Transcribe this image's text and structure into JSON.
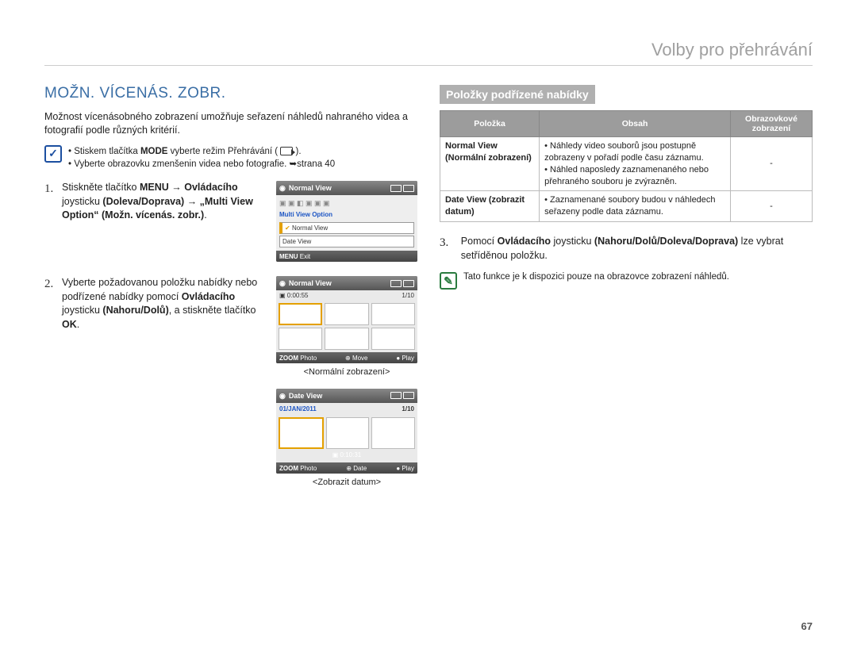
{
  "chapter": "Volby pro přehrávání",
  "section_title": "MOŽN. VÍCENÁS. ZOBR.",
  "intro": "Možnost vícenásobného zobrazení umožňuje seřazení náhledů nahraného videa a fotografií podle různých kritérií.",
  "prereq": {
    "line1_a": "Stiskem tlačítka ",
    "line1_b": "MODE",
    "line1_c": " vyberte režim Přehrávání ( ",
    "line1_d": " ).",
    "line2": "Vyberte obrazovku zmenšenin videa nebo fotografie. ➥strana 40"
  },
  "steps": {
    "s1": {
      "t1": "Stiskněte tlačítko ",
      "t2": "MENU",
      "t3": " → ",
      "t4": "Ovládacího",
      "t5": " joysticku ",
      "t6": "(Doleva/Doprava)",
      "t7": " → ",
      "t8": "„Multi View Option“ (Možn. vícenás. zobr.)",
      "t9": "."
    },
    "s2": {
      "t1": "Vyberte požadovanou položku nabídky nebo podřízené nabídky pomocí ",
      "t2": "Ovládacího",
      "t3": " joysticku ",
      "t4": "(Nahoru/Dolů)",
      "t5": ", a stiskněte tlačítko ",
      "t6": "OK",
      "t7": "."
    }
  },
  "lcd1": {
    "title": "Normal View",
    "menu_header": "Multi View Option",
    "item1": "Normal View",
    "item2": "Date View",
    "menu_btn": "MENU",
    "exit": "Exit"
  },
  "lcd2": {
    "title": "Normal View",
    "time": "0:00:55",
    "counter": "1/10",
    "zoom": "ZOOM",
    "photo": "Photo",
    "move": "Move",
    "play": "Play",
    "caption": "<Normální zobrazení>"
  },
  "lcd3": {
    "title": "Date View",
    "date": "01/JAN/2011",
    "counter": "1/10",
    "time": "0:10:31",
    "zoom": "ZOOM",
    "photo": "Photo",
    "dateLbl": "Date",
    "play": "Play",
    "caption": "<Zobrazit datum>"
  },
  "submenu_head": "Položky podřízené nabídky",
  "table": {
    "h1": "Položka",
    "h2": "Obsah",
    "h3": "Obrazovkové zobrazení",
    "r1": {
      "item": "Normal View (Normální zobrazení)",
      "c1": "Náhledy video souborů jsou postupně zobrazeny v pořadí podle času záznamu.",
      "c2": "Náhled naposledy zaznamenaného nebo přehraného souboru je zvýrazněn.",
      "disp": "-"
    },
    "r2": {
      "item": "Date View (zobrazit datum)",
      "c1": "Zaznamenané soubory budou v náhledech seřazeny podle data záznamu.",
      "disp": "-"
    }
  },
  "step3": {
    "t1": "Pomocí ",
    "t2": "Ovládacího",
    "t3": " joysticku ",
    "t4": "(Nahoru/Dolů/Doleva/Doprava)",
    "t5": " lze vybrat setříděnou položku."
  },
  "footnote": "Tato funkce je k dispozici pouze na obrazovce zobrazení náhledů.",
  "pagenum": "67"
}
